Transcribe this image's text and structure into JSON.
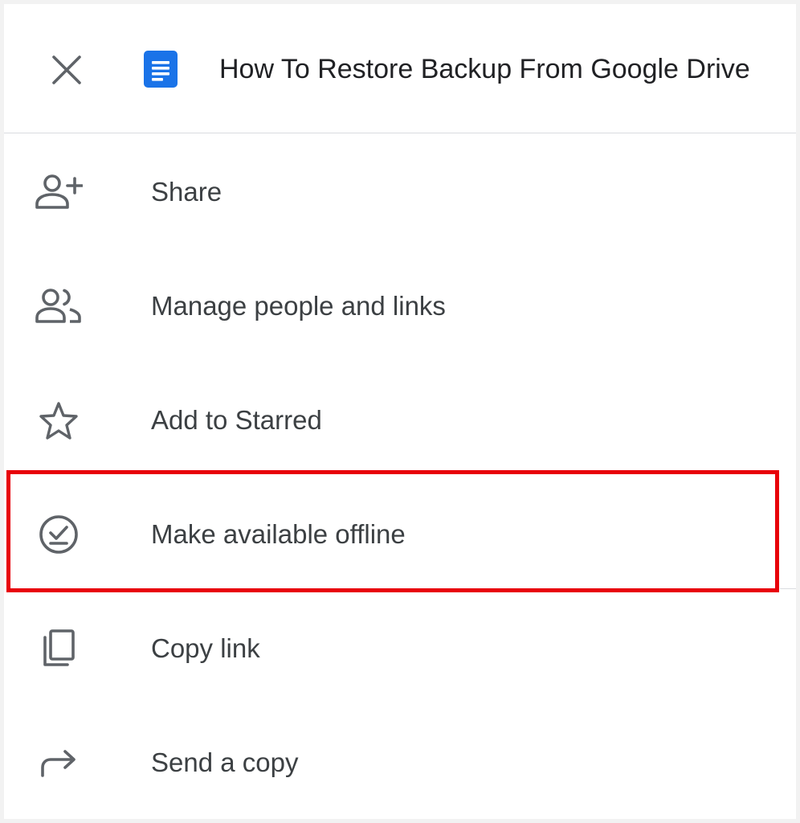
{
  "header": {
    "title": "How To Restore Backup From Google Drive",
    "close_icon": "close-icon",
    "doc_icon": "google-docs-icon",
    "doc_icon_color": "#1a73e8"
  },
  "menu": {
    "items": [
      {
        "label": "Share",
        "icon": "person-add-icon"
      },
      {
        "label": "Manage people and links",
        "icon": "people-icon"
      },
      {
        "label": "Add to Starred",
        "icon": "star-outline-icon"
      },
      {
        "label": "Make available offline",
        "icon": "offline-pin-icon"
      },
      {
        "label": "Copy link",
        "icon": "copy-icon"
      },
      {
        "label": "Send a copy",
        "icon": "forward-arrow-icon"
      }
    ]
  },
  "highlight": {
    "color": "#e8000a",
    "target": "Make available offline"
  },
  "colors": {
    "text": "#3c4043",
    "icon": "#5f6368",
    "title": "#202124",
    "divider": "#dadce0"
  }
}
